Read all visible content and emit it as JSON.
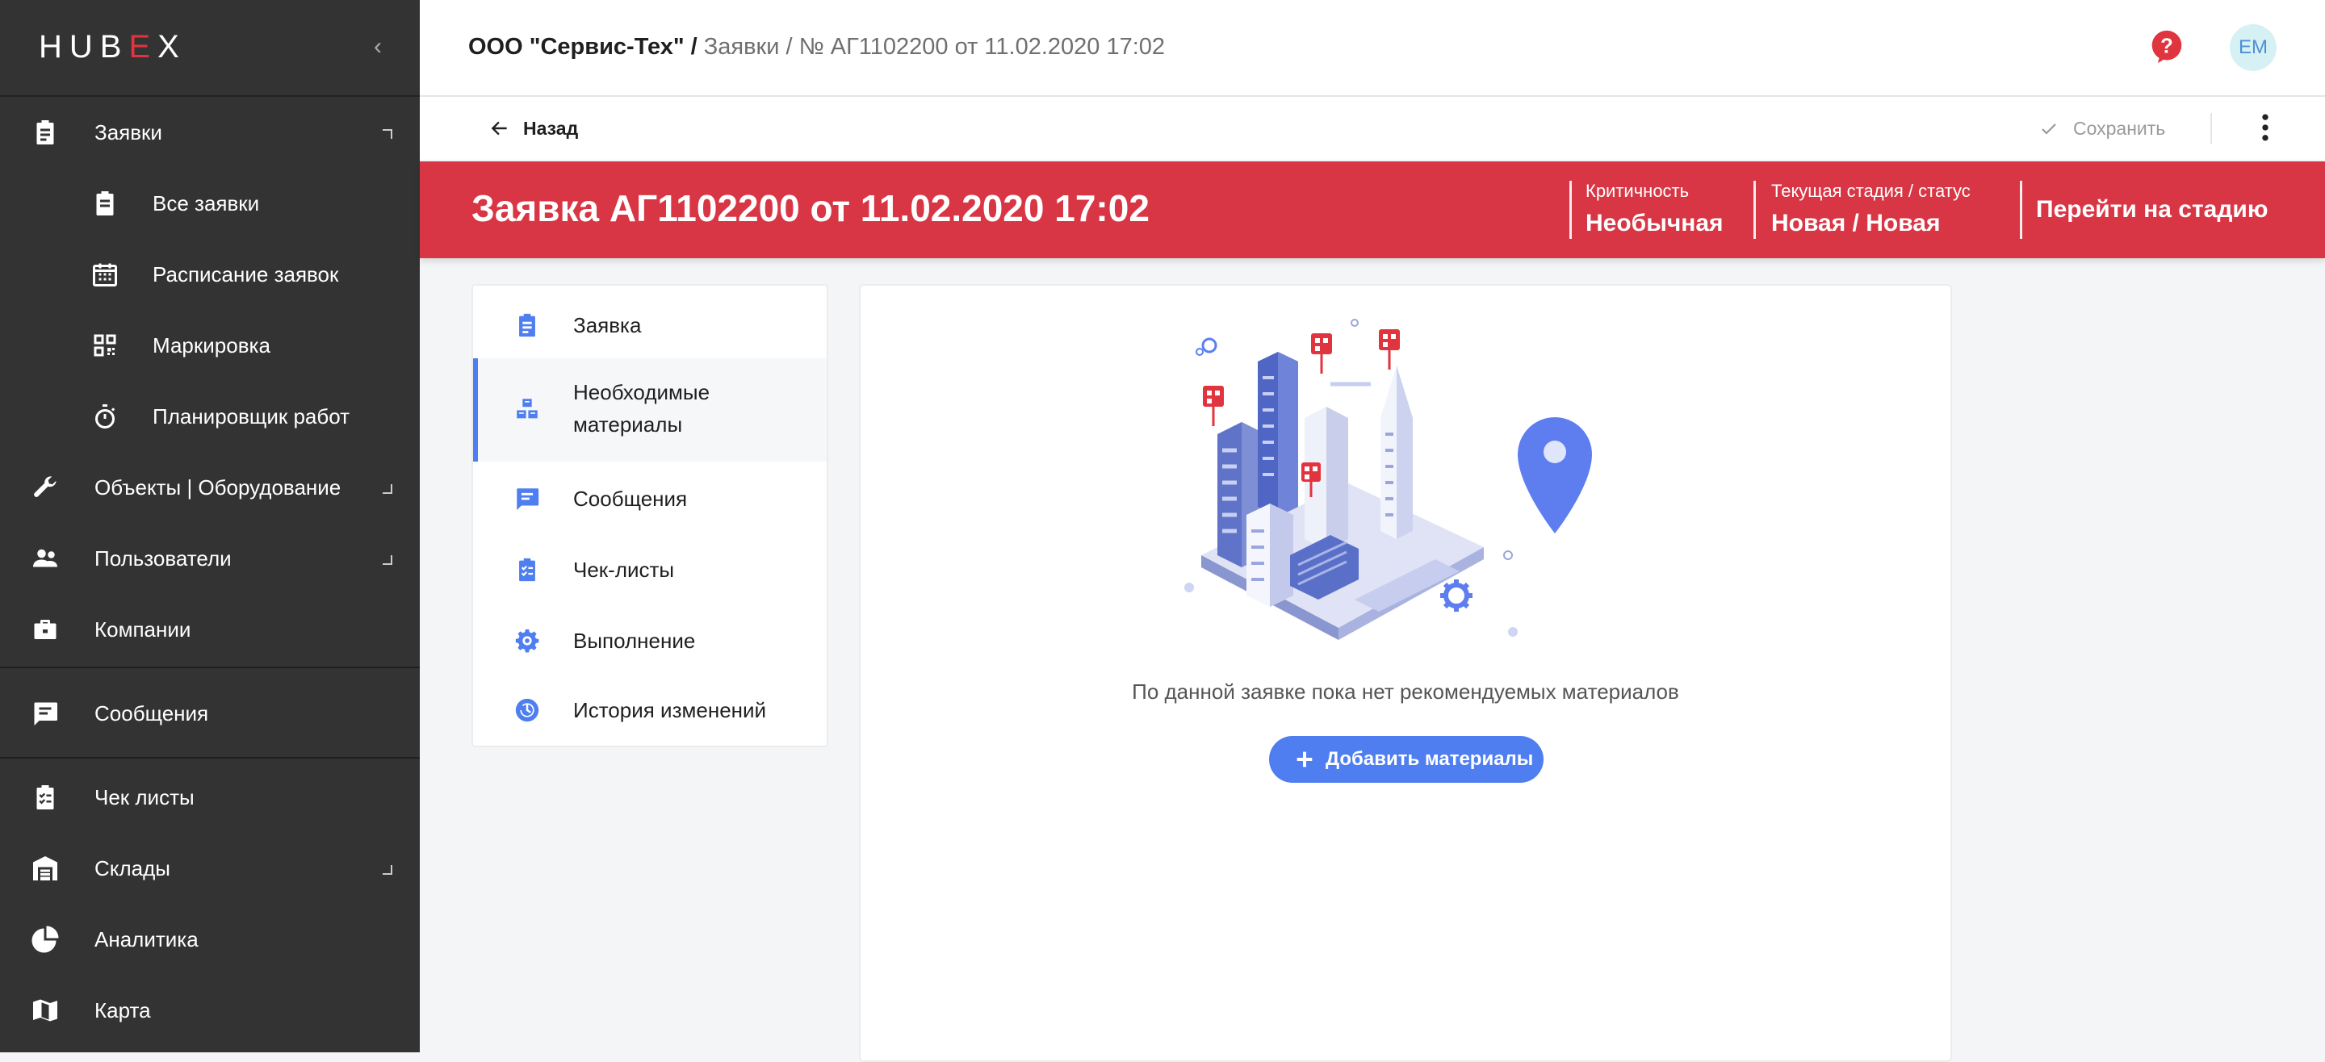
{
  "app": {
    "logo": "HUBEX"
  },
  "sidebar": {
    "items": [
      {
        "label": "Заявки",
        "icon": "clipboard-icon"
      },
      {
        "label": "Все заявки",
        "icon": "clipboard-list-icon"
      },
      {
        "label": "Расписание заявок",
        "icon": "calendar-icon"
      },
      {
        "label": "Маркировка",
        "icon": "qr-code-icon"
      },
      {
        "label": "Планировщик работ",
        "icon": "stopwatch-icon"
      },
      {
        "label": "Объекты | Оборудование",
        "icon": "wrench-icon"
      },
      {
        "label": "Пользователи",
        "icon": "users-icon"
      },
      {
        "label": "Компании",
        "icon": "briefcase-icon"
      },
      {
        "label": "Сообщения",
        "icon": "chat-icon"
      },
      {
        "label": "Чек листы",
        "icon": "checklist-icon"
      },
      {
        "label": "Склады",
        "icon": "warehouse-icon"
      },
      {
        "label": "Аналитика",
        "icon": "pie-chart-icon"
      },
      {
        "label": "Карта",
        "icon": "map-icon"
      }
    ]
  },
  "header": {
    "org": "ООО \"Сервис-Тех\" /",
    "path": " Заявки / № АГ1102200 от 11.02.2020 17:02",
    "avatar_initials": "ЕМ",
    "help_color": "#e0343f"
  },
  "subbar": {
    "back_label": "Назад",
    "save_label": "Сохранить"
  },
  "ticket": {
    "title": "Заявка АГ1102200 от 11.02.2020 17:02",
    "criticality_label": "Критичность",
    "criticality_value": "Необычная",
    "stage_label": "Текущая стадия / статус",
    "stage_value": "Новая / Новая",
    "goto_stage": "Перейти на стадию",
    "header_color": "#d93645"
  },
  "tabs": [
    {
      "label": "Заявка",
      "icon": "clipboard-icon"
    },
    {
      "label_line1": "Необходимые",
      "label_line2": "материалы",
      "icon": "boxes-icon",
      "active": true
    },
    {
      "label": "Сообщения",
      "icon": "chat-icon"
    },
    {
      "label": "Чек-листы",
      "icon": "checklist-icon"
    },
    {
      "label": "Выполнение",
      "icon": "gear-icon"
    },
    {
      "label": "История изменений",
      "icon": "clock-icon"
    }
  ],
  "materials": {
    "empty_text": "По данной заявке пока нет рекомендуемых материалов",
    "add_button": "Добавить материалы",
    "accent_color": "#4f7ef0"
  }
}
